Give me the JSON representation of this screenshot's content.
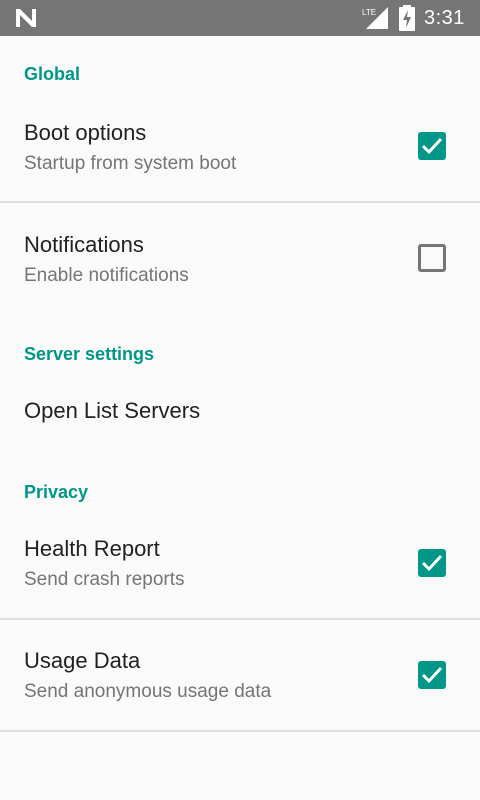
{
  "status_bar": {
    "network": "LTE",
    "time": "3:31"
  },
  "sections": {
    "global": "Global",
    "server_settings": "Server settings",
    "privacy": "Privacy"
  },
  "prefs": {
    "boot_options": {
      "title": "Boot options",
      "summary": "Startup from system boot",
      "checked": true
    },
    "notifications": {
      "title": "Notifications",
      "summary": "Enable notifications",
      "checked": false
    },
    "open_list_servers": {
      "title": "Open List Servers"
    },
    "health_report": {
      "title": "Health Report",
      "summary": "Send crash reports",
      "checked": true
    },
    "usage_data": {
      "title": "Usage Data",
      "summary": "Send anonymous usage data",
      "checked": true
    }
  },
  "colors": {
    "accent": "#009688",
    "status_bar": "#757575",
    "background": "#fafafa"
  }
}
